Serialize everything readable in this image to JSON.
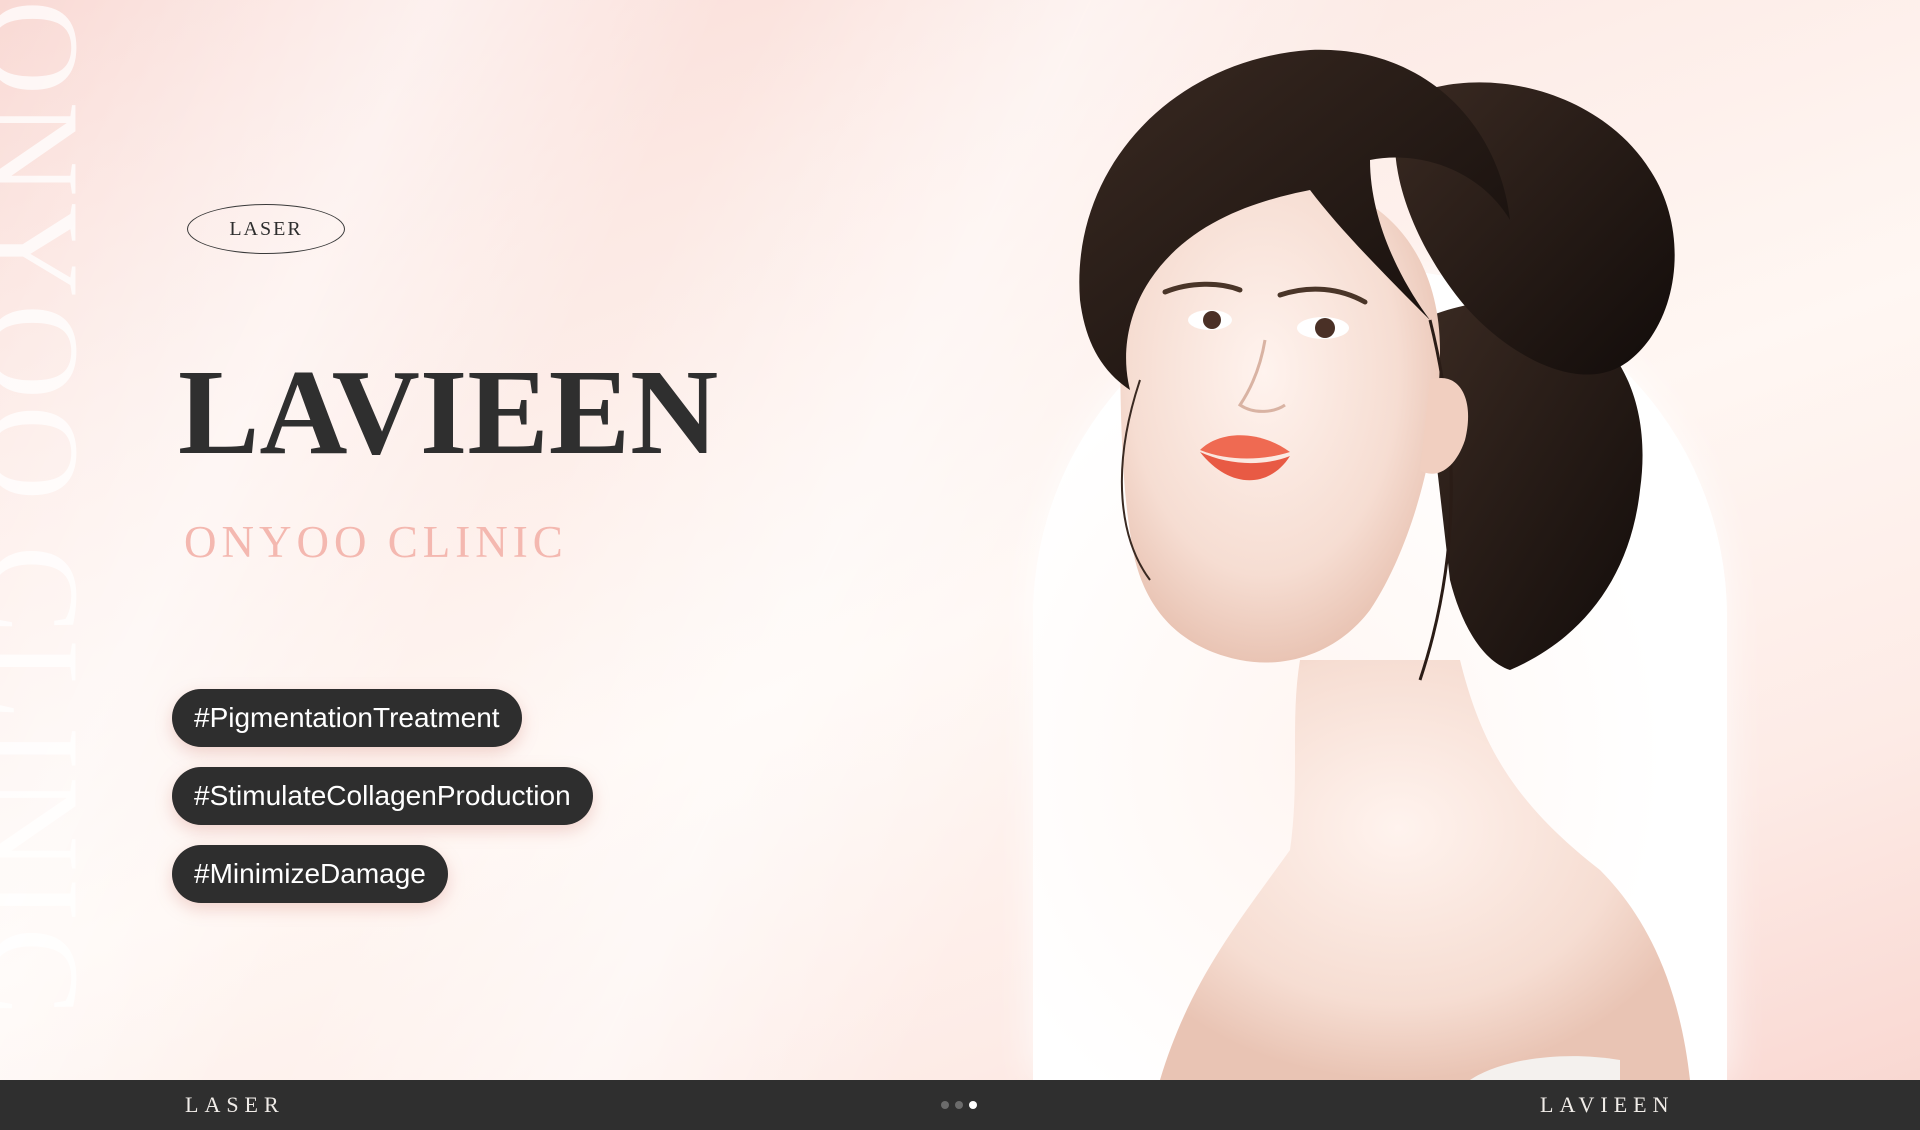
{
  "background": {
    "vertical_text": "ONYOO CLINIC"
  },
  "hero": {
    "category": "LASER",
    "title": "LAVIEEN",
    "subtitle": "ONYOO CLINIC",
    "tags": [
      "#PigmentationTreatment",
      "#StimulateCollagenProduction",
      "#MinimizeDamage"
    ]
  },
  "footer": {
    "left_label": "LASER",
    "right_label": "LAVIEEN",
    "slide_indicator": {
      "total": 3,
      "active": 3
    }
  },
  "colors": {
    "dark": "#2f2f2f",
    "accent_pink": "#f4b8b0",
    "background_pink": "#fdf0ec"
  }
}
